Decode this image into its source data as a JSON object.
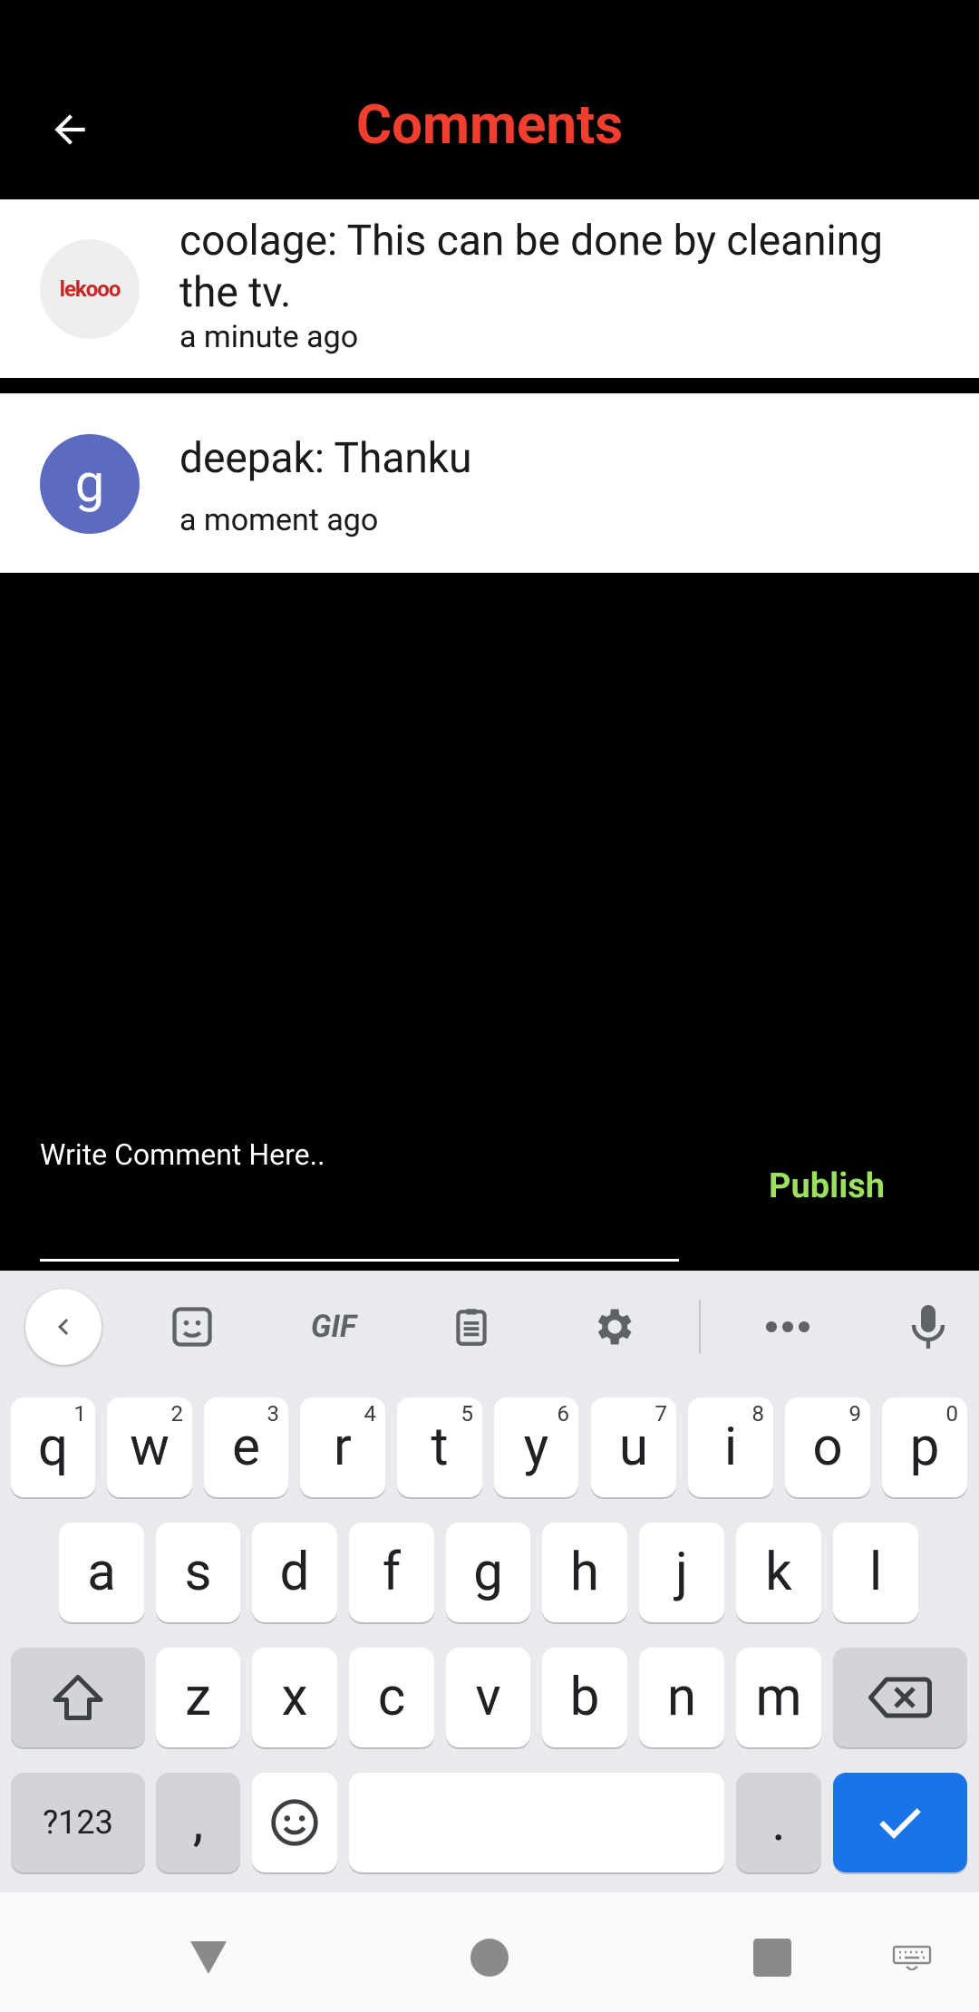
{
  "header": {
    "title": "Comments"
  },
  "comments": [
    {
      "author": "coolage:",
      "text": "This can be done by cleaning the tv.",
      "line": "coolage:  This can be done by cleaning the tv.",
      "time": "a minute ago",
      "avatar_text": "lekooo"
    },
    {
      "author": "deepak:",
      "text": "Thanku",
      "line": "deepak:  Thanku",
      "time": "a moment ago",
      "avatar_letter": "g"
    }
  ],
  "composer": {
    "placeholder": "Write Comment Here..",
    "publish_label": "Publish"
  },
  "keyboard": {
    "toolbar": [
      "collapse-icon",
      "sticker-icon",
      "gif-icon",
      "clipboard-icon",
      "gear-icon",
      "more-icon",
      "mic-icon"
    ],
    "gif_label": "GIF",
    "row1": [
      {
        "k": "q",
        "h": "1"
      },
      {
        "k": "w",
        "h": "2"
      },
      {
        "k": "e",
        "h": "3"
      },
      {
        "k": "r",
        "h": "4"
      },
      {
        "k": "t",
        "h": "5"
      },
      {
        "k": "y",
        "h": "6"
      },
      {
        "k": "u",
        "h": "7"
      },
      {
        "k": "i",
        "h": "8"
      },
      {
        "k": "o",
        "h": "9"
      },
      {
        "k": "p",
        "h": "0"
      }
    ],
    "row2": [
      "a",
      "s",
      "d",
      "f",
      "g",
      "h",
      "j",
      "k",
      "l"
    ],
    "row3": [
      "z",
      "x",
      "c",
      "v",
      "b",
      "n",
      "m"
    ],
    "symbols_label": "?123",
    "comma_label": ",",
    "period_label": "."
  },
  "colors": {
    "title": "#f03e2f",
    "publish": "#9be15d",
    "avatar_bg": "#5c6bc0",
    "enter_key": "#1a73e8"
  }
}
